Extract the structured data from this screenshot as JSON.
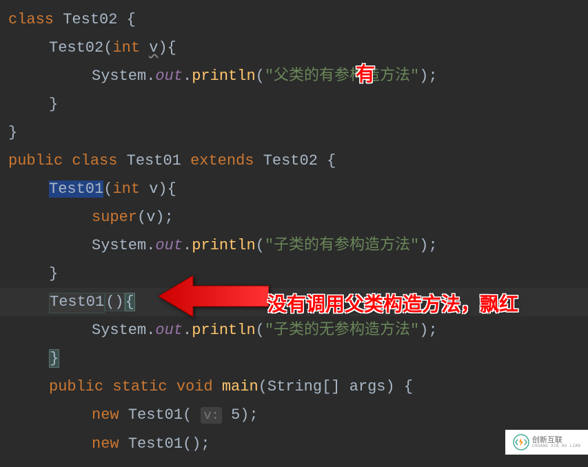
{
  "code": {
    "l1_kw_class": "class",
    "l1_name": " Test02 {",
    "l2_name": "Test02(",
    "l2_kw_int": "int",
    "l2_param": " ",
    "l2_param_v": "v",
    "l2_rest": "){",
    "l3_obj": "System.",
    "l3_out": "out",
    "l3_dot": ".",
    "l3_method": "println",
    "l3_open": "(",
    "l3_str": "\"父类的有参构造方法\"",
    "l3_close": ");",
    "l4_brace": "}",
    "l5_brace": "}",
    "l6_kw_public": "public",
    "l6_sp1": " ",
    "l6_kw_class": "class",
    "l6_sp2": " ",
    "l6_name": "Test01",
    "l6_sp3": " ",
    "l6_kw_extends": "extends",
    "l6_sp4": " ",
    "l6_parent": "Test02 {",
    "l7_name_sel": "Test01",
    "l7_open": "(",
    "l7_kw_int": "int",
    "l7_rest": " v){",
    "l8_kw_super": "super",
    "l8_rest": "(v);",
    "l9_obj": "System.",
    "l9_out": "out",
    "l9_dot": ".",
    "l9_method": "println",
    "l9_open": "(",
    "l9_str": "\"子类的有参构造方法\"",
    "l9_close": ");",
    "l10_brace": "}",
    "l11_name_err": "Test01",
    "l11_rest": "()",
    "l11_brace": "{",
    "l12_obj": "System.",
    "l12_out": "out",
    "l12_dot": ".",
    "l12_method": "println",
    "l12_open": "(",
    "l12_str": "\"子类的无参构造方法\"",
    "l12_close": ");",
    "l13_brace": "}",
    "l14_kw_public": "public",
    "l14_sp1": " ",
    "l14_kw_static": "static",
    "l14_sp2": " ",
    "l14_kw_void": "void",
    "l14_sp3": " ",
    "l14_method": "main",
    "l14_rest": "(String[] args) {",
    "l15_kw_new": "new",
    "l15_sp": " ",
    "l15_name": "Test01( ",
    "l15_hint": "v:",
    "l15_val": " 5);",
    "l16_kw_new": "new",
    "l16_sp": " ",
    "l16_name": "Test01();"
  },
  "annotations": {
    "typo_overlay": "有",
    "error_comment": "没有调用父类构造方法，飘红"
  },
  "watermark": {
    "zh": "创新互联",
    "py": "CHUANG XIN HU LIAN"
  }
}
